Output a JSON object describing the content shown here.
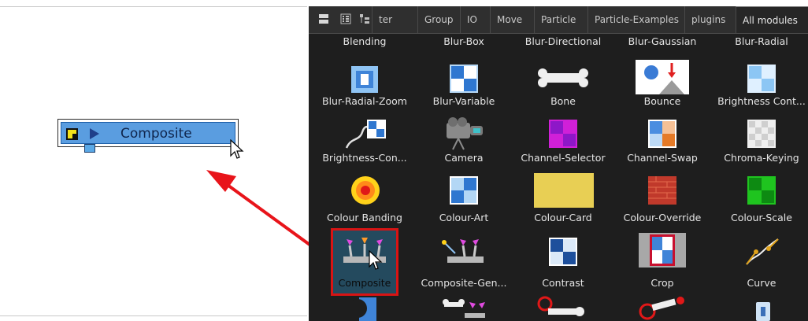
{
  "canvas": {
    "node": {
      "label": "Composite"
    }
  },
  "panel": {
    "tabs": [
      {
        "label": "ter"
      },
      {
        "label": "Group"
      },
      {
        "label": "IO"
      },
      {
        "label": "Move"
      },
      {
        "label": "Particle"
      },
      {
        "label": "Particle-Examples"
      },
      {
        "label": "plugins"
      },
      {
        "label": "All modules",
        "active": true
      }
    ],
    "rows": [
      [
        "Blending",
        "Blur-Box",
        "Blur-Directional",
        "Blur-Gaussian",
        "Blur-Radial"
      ],
      [
        "Blur-Radial-Zoom",
        "Blur-Variable",
        "Bone",
        "Bounce",
        "Brightness Cont..."
      ],
      [
        "Brightness-Con...",
        "Camera",
        "Channel-Selector",
        "Channel-Swap",
        "Chroma-Keying"
      ],
      [
        "Colour Banding",
        "Colour-Art",
        "Colour-Card",
        "Colour-Override",
        "Colour-Scale"
      ],
      [
        "Composite",
        "Composite-Gen...",
        "Contrast",
        "Crop",
        "Curve"
      ]
    ],
    "selected_module": "Composite"
  },
  "colors": {
    "highlight": "#d81414",
    "node_fill": "#5a9de0",
    "panel_bg": "#1e1e1e"
  }
}
